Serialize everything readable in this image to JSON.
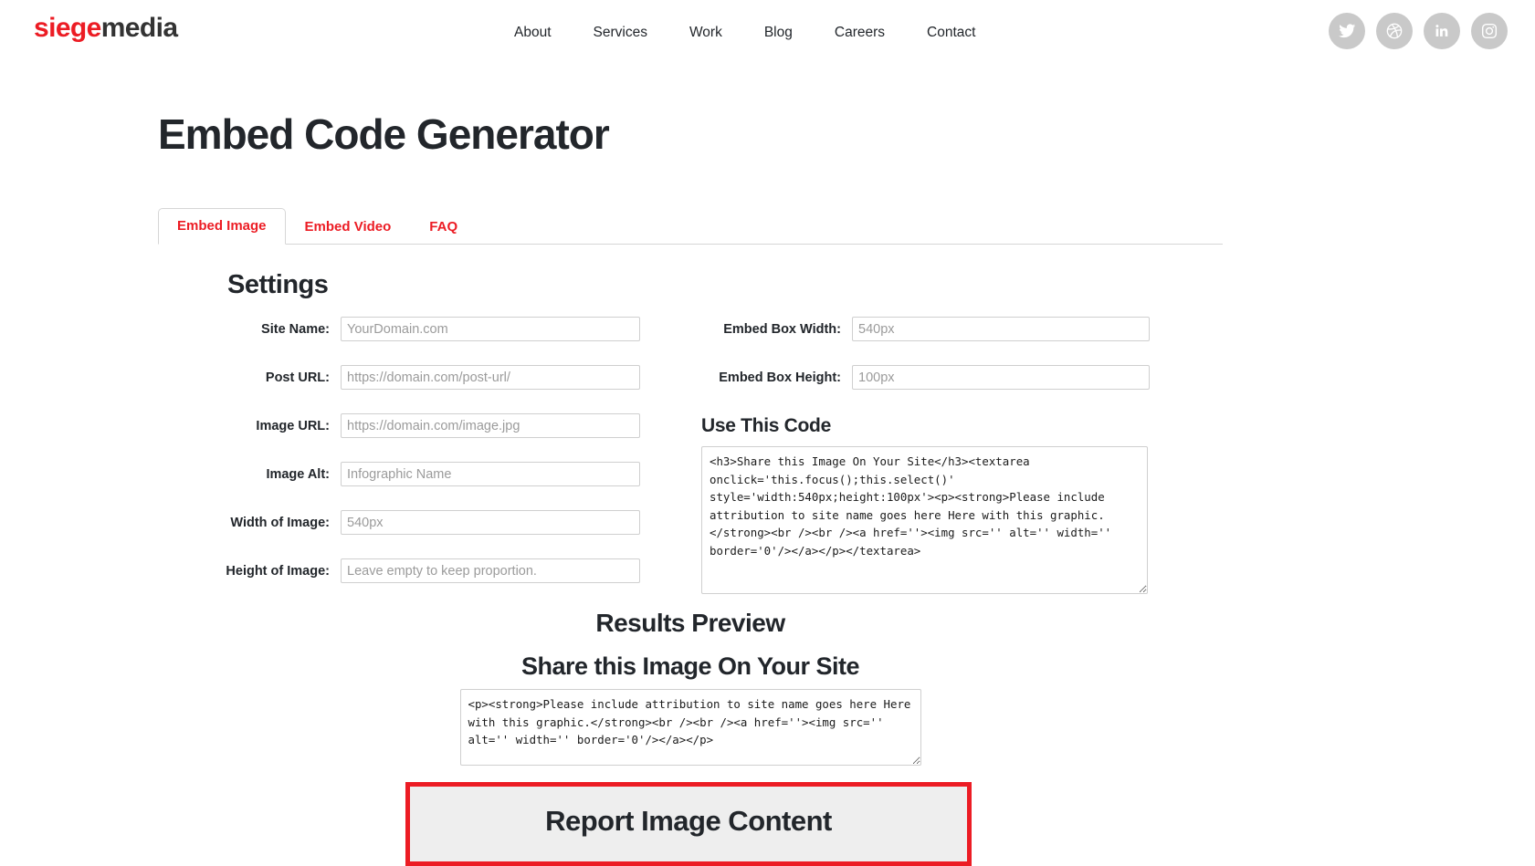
{
  "header": {
    "logo": {
      "part1": "siege",
      "part2": "media",
      "accent_color": "#ec1c24",
      "dark_color": "#333333"
    },
    "nav": [
      {
        "label": "About"
      },
      {
        "label": "Services"
      },
      {
        "label": "Work"
      },
      {
        "label": "Blog"
      },
      {
        "label": "Careers"
      },
      {
        "label": "Contact"
      }
    ],
    "social": [
      {
        "icon": "twitter-icon"
      },
      {
        "icon": "dribbble-icon"
      },
      {
        "icon": "linkedin-icon"
      },
      {
        "icon": "instagram-icon"
      }
    ]
  },
  "page": {
    "title": "Embed Code Generator"
  },
  "tabs": [
    {
      "label": "Embed Image",
      "active": true
    },
    {
      "label": "Embed Video",
      "active": false
    },
    {
      "label": "FAQ",
      "active": false
    }
  ],
  "settings": {
    "heading": "Settings",
    "left_fields": [
      {
        "label": "Site Name:",
        "value": "",
        "placeholder": "YourDomain.com"
      },
      {
        "label": "Post URL:",
        "value": "",
        "placeholder": "https://domain.com/post-url/"
      },
      {
        "label": "Image URL:",
        "value": "",
        "placeholder": "https://domain.com/image.jpg"
      },
      {
        "label": "Image Alt:",
        "value": "",
        "placeholder": "Infographic Name"
      },
      {
        "label": "Width of Image:",
        "value": "",
        "placeholder": "540px"
      },
      {
        "label": "Height of Image:",
        "value": "",
        "placeholder": "Leave empty to keep proportion."
      }
    ],
    "right_fields": [
      {
        "label": "Embed Box Width:",
        "value": "",
        "placeholder": "540px"
      },
      {
        "label": "Embed Box Height:",
        "value": "",
        "placeholder": "100px"
      }
    ]
  },
  "use_this_code": {
    "heading": "Use This Code",
    "code": "<h3>Share this Image On Your Site</h3><textarea onclick='this.focus();this.select()' style='width:540px;height:100px'><p><strong>Please include attribution to site name goes here Here with this graphic.</strong><br /><br /><a href=''><img src='' alt='' width='' border='0'/></a></p></textarea>"
  },
  "results_preview": {
    "heading": "Results Preview",
    "share_heading": "Share this Image On Your Site",
    "code": "<p><strong>Please include attribution to site name goes here Here with this graphic.</strong><br /><br /><a href=''><img src='' alt='' width='' border='0'/></a></p>"
  },
  "bottom_box": {
    "text": "Report Image Content",
    "border_color": "#ec1c24",
    "background_color": "#eeeeee"
  }
}
